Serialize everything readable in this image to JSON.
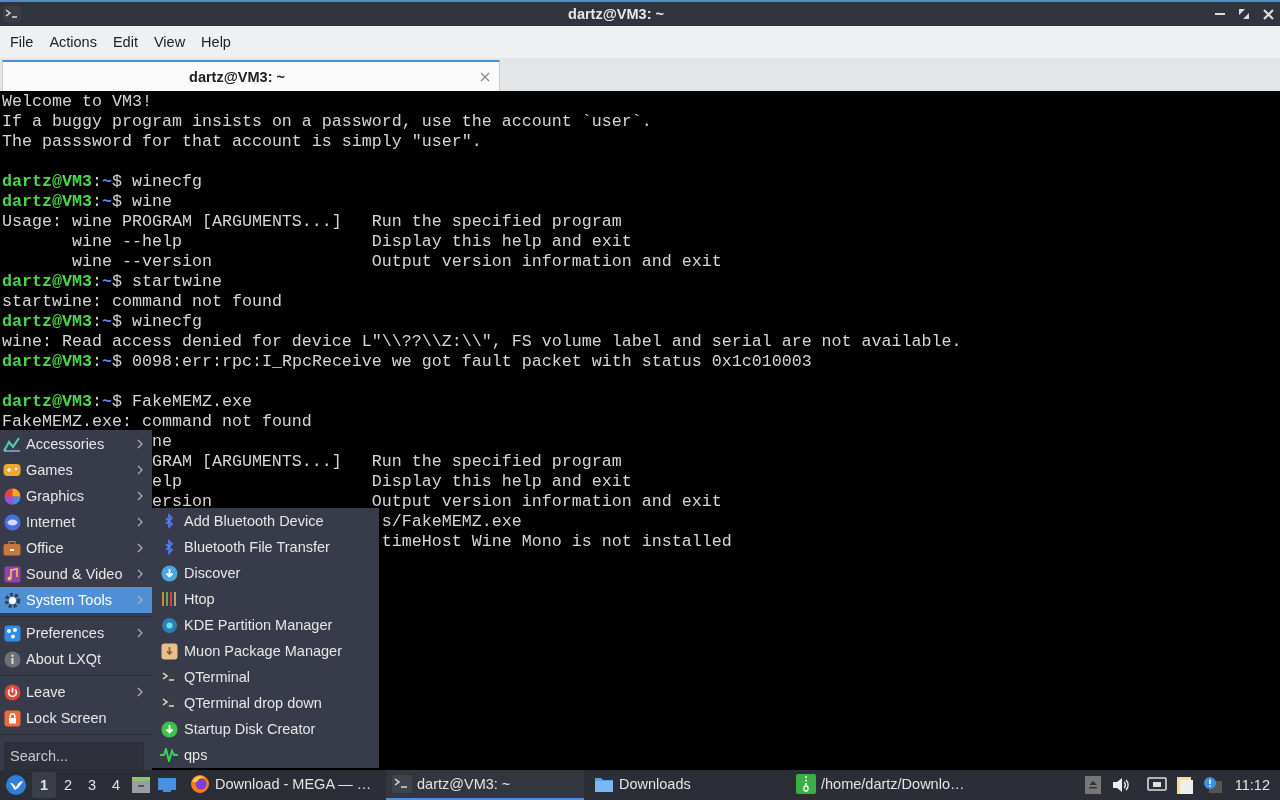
{
  "window": {
    "title": "dartz@VM3: ~"
  },
  "menubar": [
    "File",
    "Actions",
    "Edit",
    "View",
    "Help"
  ],
  "tabs": [
    {
      "label": "dartz@VM3: ~",
      "selected": true
    }
  ],
  "terminal": {
    "lines": [
      {
        "kind": "output",
        "text": "Welcome to VM3!"
      },
      {
        "kind": "output",
        "text": "If a buggy program insists on a password, use the account `user`."
      },
      {
        "kind": "output",
        "text": "The passsword for that account is simply \"user\"."
      },
      {
        "kind": "blank"
      },
      {
        "kind": "prompt",
        "user": "dartz@VM3",
        "sep": ":",
        "path": "~",
        "symbol": "$",
        "command": "winecfg"
      },
      {
        "kind": "prompt",
        "user": "dartz@VM3",
        "sep": ":",
        "path": "~",
        "symbol": "$",
        "command": "wine"
      },
      {
        "kind": "output",
        "text": "Usage: wine PROGRAM [ARGUMENTS...]   Run the specified program"
      },
      {
        "kind": "output",
        "text": "       wine --help                   Display this help and exit"
      },
      {
        "kind": "output",
        "text": "       wine --version                Output version information and exit"
      },
      {
        "kind": "prompt",
        "user": "dartz@VM3",
        "sep": ":",
        "path": "~",
        "symbol": "$",
        "command": "startwine"
      },
      {
        "kind": "output",
        "text": "startwine: command not found"
      },
      {
        "kind": "prompt",
        "user": "dartz@VM3",
        "sep": ":",
        "path": "~",
        "symbol": "$",
        "command": "winecfg"
      },
      {
        "kind": "output",
        "text": "wine: Read access denied for device L\"\\\\??\\\\Z:\\\\\", FS volume label and serial are not available."
      },
      {
        "kind": "prompt",
        "user": "dartz@VM3",
        "sep": ":",
        "path": "~",
        "symbol": "$",
        "command": "0098:err:rpc:I_RpcReceive we got fault packet with status 0x1c010003"
      },
      {
        "kind": "blank"
      },
      {
        "kind": "prompt",
        "user": "dartz@VM3",
        "sep": ":",
        "path": "~",
        "symbol": "$",
        "command": "FakeMEMZ.exe"
      },
      {
        "kind": "output",
        "text": "FakeMEMZ.exe: command not found"
      },
      {
        "kind": "output",
        "text": "               ne"
      },
      {
        "kind": "output",
        "text": "               GRAM [ARGUMENTS...]   Run the specified program"
      },
      {
        "kind": "output",
        "text": "               elp                   Display this help and exit"
      },
      {
        "kind": "output",
        "text": "               ersion                Output version information and exit"
      },
      {
        "kind": "output",
        "text": "                                      s/FakeMEMZ.exe"
      },
      {
        "kind": "output",
        "text": "                                      timeHost Wine Mono is not installed"
      }
    ]
  },
  "app_menu": {
    "groups": [
      {
        "items": [
          {
            "label": "Accessories",
            "submenu": true,
            "selected": false
          },
          {
            "label": "Games",
            "submenu": true,
            "selected": false
          },
          {
            "label": "Graphics",
            "submenu": true,
            "selected": false
          },
          {
            "label": "Internet",
            "submenu": true,
            "selected": false
          },
          {
            "label": "Office",
            "submenu": true,
            "selected": false
          },
          {
            "label": "Sound & Video",
            "submenu": true,
            "selected": false
          },
          {
            "label": "System Tools",
            "submenu": true,
            "selected": true
          }
        ]
      },
      {
        "items": [
          {
            "label": "Preferences",
            "submenu": true,
            "selected": false
          },
          {
            "label": "About LXQt",
            "submenu": false,
            "selected": false
          }
        ]
      },
      {
        "items": [
          {
            "label": "Leave",
            "submenu": true,
            "selected": false
          },
          {
            "label": "Lock Screen",
            "submenu": false,
            "selected": false
          }
        ]
      }
    ],
    "search": {
      "placeholder": "Search..."
    }
  },
  "submenu": {
    "items": [
      {
        "label": "Add Bluetooth Device"
      },
      {
        "label": "Bluetooth File Transfer"
      },
      {
        "label": "Discover"
      },
      {
        "label": "Htop"
      },
      {
        "label": "KDE Partition Manager"
      },
      {
        "label": "Muon Package Manager"
      },
      {
        "label": "QTerminal"
      },
      {
        "label": "QTerminal drop down"
      },
      {
        "label": "Startup Disk Creator"
      },
      {
        "label": "qps"
      }
    ]
  },
  "taskbar": {
    "desktops": [
      {
        "label": "1",
        "selected": true
      },
      {
        "label": "2",
        "selected": false
      },
      {
        "label": "3",
        "selected": false
      },
      {
        "label": "4",
        "selected": false
      }
    ],
    "tasks": [
      {
        "label": "Download - MEGA — …",
        "active": false
      },
      {
        "label": "dartz@VM3: ~",
        "active": true
      },
      {
        "label": "Downloads",
        "active": false
      },
      {
        "label": "/home/dartz/Downlo…",
        "active": false
      }
    ],
    "clock": "11:12"
  }
}
